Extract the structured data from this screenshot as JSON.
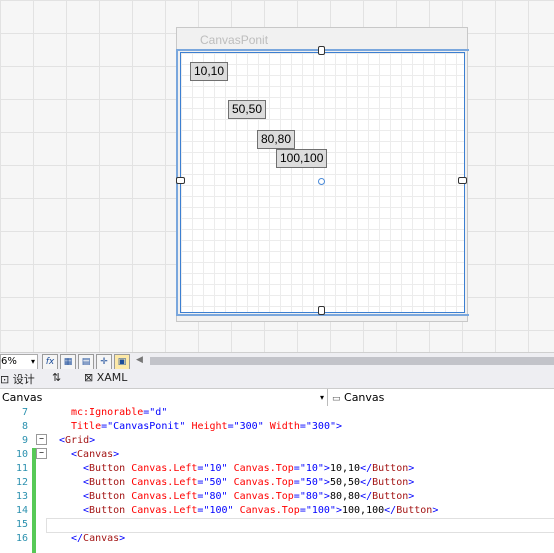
{
  "window": {
    "title": "CanvasPonit"
  },
  "buttons": [
    "10,10",
    "50,50",
    "80,80",
    "100,100"
  ],
  "toolbar": {
    "zoom": "6%",
    "fx": "fx"
  },
  "tabs": {
    "design": "设计",
    "swap": "⇅",
    "xaml": "XAML"
  },
  "selectors": {
    "left": "Canvas",
    "right": "Canvas"
  },
  "editor": {
    "lines": [
      {
        "num": "7",
        "indent": 4,
        "parts": [
          [
            "a",
            "mc:Ignorable"
          ],
          [
            "p",
            "="
          ],
          [
            "v",
            "\"d\""
          ]
        ]
      },
      {
        "num": "8",
        "indent": 4,
        "parts": [
          [
            "a",
            "Title"
          ],
          [
            "p",
            "="
          ],
          [
            "v",
            "\"CanvasPonit\""
          ],
          [
            "tx",
            " "
          ],
          [
            "a",
            "Height"
          ],
          [
            "p",
            "="
          ],
          [
            "v",
            "\"300\""
          ],
          [
            "tx",
            " "
          ],
          [
            "a",
            "Width"
          ],
          [
            "p",
            "="
          ],
          [
            "v",
            "\"300\""
          ],
          [
            "p",
            ">"
          ]
        ]
      },
      {
        "num": "9",
        "indent": 2,
        "parts": [
          [
            "p",
            "<"
          ],
          [
            "t",
            "Grid"
          ],
          [
            "p",
            ">"
          ]
        ]
      },
      {
        "num": "10",
        "indent": 4,
        "parts": [
          [
            "p",
            "<"
          ],
          [
            "t",
            "Canvas"
          ],
          [
            "p",
            ">"
          ]
        ]
      },
      {
        "num": "11",
        "indent": 6,
        "parts": [
          [
            "p",
            "<"
          ],
          [
            "t",
            "Button"
          ],
          [
            "tx",
            " "
          ],
          [
            "a",
            "Canvas.Left"
          ],
          [
            "p",
            "="
          ],
          [
            "v",
            "\"10\""
          ],
          [
            "tx",
            " "
          ],
          [
            "a",
            "Canvas.Top"
          ],
          [
            "p",
            "="
          ],
          [
            "v",
            "\"10\""
          ],
          [
            "p",
            ">"
          ],
          [
            "tx",
            "10,10"
          ],
          [
            "p",
            "</"
          ],
          [
            "t",
            "Button"
          ],
          [
            "p",
            ">"
          ]
        ]
      },
      {
        "num": "12",
        "indent": 6,
        "parts": [
          [
            "p",
            "<"
          ],
          [
            "t",
            "Button"
          ],
          [
            "tx",
            " "
          ],
          [
            "a",
            "Canvas.Left"
          ],
          [
            "p",
            "="
          ],
          [
            "v",
            "\"50\""
          ],
          [
            "tx",
            " "
          ],
          [
            "a",
            "Canvas.Top"
          ],
          [
            "p",
            "="
          ],
          [
            "v",
            "\"50\""
          ],
          [
            "p",
            ">"
          ],
          [
            "tx",
            "50,50"
          ],
          [
            "p",
            "</"
          ],
          [
            "t",
            "Button"
          ],
          [
            "p",
            ">"
          ]
        ]
      },
      {
        "num": "13",
        "indent": 6,
        "parts": [
          [
            "p",
            "<"
          ],
          [
            "t",
            "Button"
          ],
          [
            "tx",
            " "
          ],
          [
            "a",
            "Canvas.Left"
          ],
          [
            "p",
            "="
          ],
          [
            "v",
            "\"80\""
          ],
          [
            "tx",
            " "
          ],
          [
            "a",
            "Canvas.Top"
          ],
          [
            "p",
            "="
          ],
          [
            "v",
            "\"80\""
          ],
          [
            "p",
            ">"
          ],
          [
            "tx",
            "80,80"
          ],
          [
            "p",
            "</"
          ],
          [
            "t",
            "Button"
          ],
          [
            "p",
            ">"
          ]
        ]
      },
      {
        "num": "14",
        "indent": 6,
        "parts": [
          [
            "p",
            "<"
          ],
          [
            "t",
            "Button"
          ],
          [
            "tx",
            " "
          ],
          [
            "a",
            "Canvas.Left"
          ],
          [
            "p",
            "="
          ],
          [
            "v",
            "\"100\""
          ],
          [
            "tx",
            " "
          ],
          [
            "a",
            "Canvas.Top"
          ],
          [
            "p",
            "="
          ],
          [
            "v",
            "\"100\""
          ],
          [
            "p",
            ">"
          ],
          [
            "tx",
            "100,100"
          ],
          [
            "p",
            "</"
          ],
          [
            "t",
            "Button"
          ],
          [
            "p",
            ">"
          ]
        ]
      },
      {
        "num": "15",
        "indent": 0,
        "parts": []
      },
      {
        "num": "16",
        "indent": 4,
        "parts": [
          [
            "p",
            "</"
          ],
          [
            "t",
            "Canvas"
          ],
          [
            "p",
            ">"
          ]
        ]
      }
    ]
  }
}
